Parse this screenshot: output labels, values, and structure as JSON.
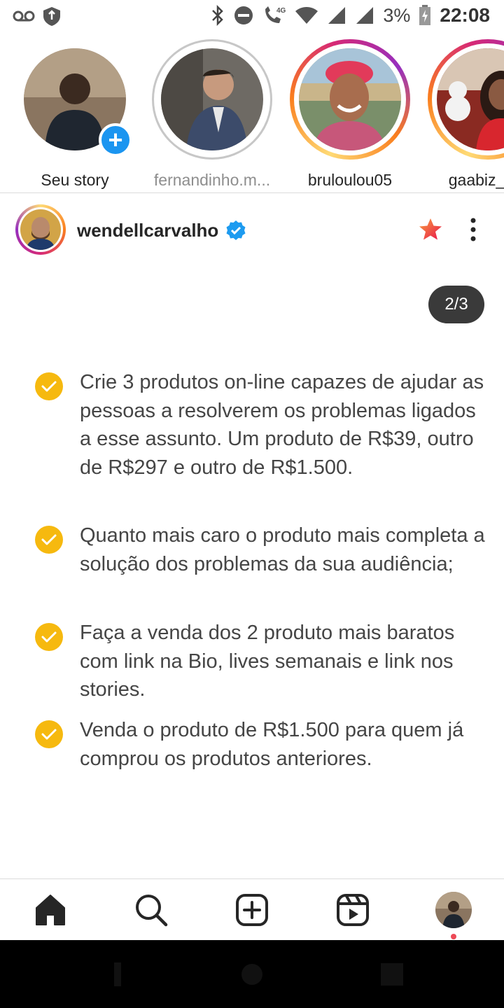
{
  "status_bar": {
    "battery": "3%",
    "time": "22:08",
    "network": "4G"
  },
  "stories": [
    {
      "label": "Seu story",
      "ring": "none",
      "own": true
    },
    {
      "label": "fernandinho.m...",
      "ring": "seen",
      "own": false
    },
    {
      "label": "bruloulou05",
      "ring": "active",
      "own": false
    },
    {
      "label": "gaabiz_car",
      "ring": "active",
      "own": false
    }
  ],
  "post": {
    "username": "wendellcarvalho",
    "verified": true,
    "counter": "2/3",
    "items": [
      "Crie 3 produtos on-line capazes de ajudar as pessoas a resolverem os problemas ligados a esse assunto. Um produto de R$39, outro de R$297 e outro de R$1.500.",
      "Quanto mais caro o produto mais completa a solução dos problemas da sua audiência;",
      "Faça a venda dos 2 produto mais baratos com link na Bio, lives semanais e link nos stories.",
      "Venda o produto de R$1.500 para quem já comprou os produtos anteriores."
    ]
  },
  "bottom_nav": [
    "home-icon",
    "search-icon",
    "new-post-icon",
    "reels-icon",
    "profile-avatar"
  ],
  "colors": {
    "check": "#f6b90f",
    "verified": "#1d9bf0",
    "star": "#f55b30",
    "add_badge": "#1b95f0",
    "notif": "#ed4956"
  }
}
